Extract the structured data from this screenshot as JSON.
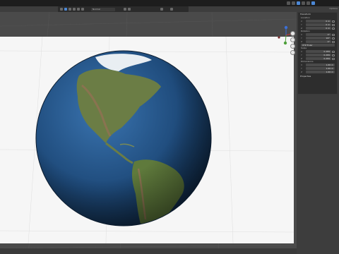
{
  "toolbar": {
    "view_dropdown": "Normal",
    "options_label": "Options"
  },
  "npanel": {
    "transform_header": "Transform",
    "location": {
      "label": "Location",
      "x": "0 m",
      "y": "0 m",
      "z": "0 m"
    },
    "rotation": {
      "label": "Rotation",
      "x": "0°",
      "y": "90°",
      "z": "0°",
      "mode": "XYZ Euler"
    },
    "scale": {
      "label": "Scale",
      "x": "0.289",
      "y": "0.289",
      "z": "0.289"
    },
    "dimensions": {
      "label": "Dimensions",
      "x": "1.66 m",
      "y": "1.66 m",
      "z": "1.66 m"
    },
    "properties_header": "Properties"
  },
  "colors": {
    "plane": "#f6f6f6",
    "ocean": "#1e4a7a",
    "land": "#6b7d45",
    "panel": "#2d2d2d",
    "accent": "#4c88d6"
  },
  "icons": [
    "view-icon",
    "cursor-icon",
    "move-icon",
    "lock-icon",
    "filter-icon",
    "gizmo-icon",
    "shading-icon"
  ]
}
